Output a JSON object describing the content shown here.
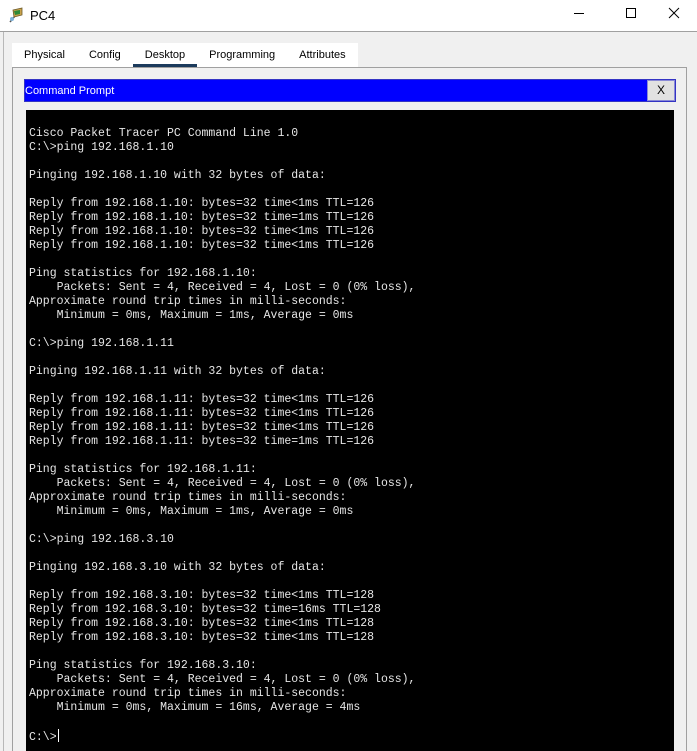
{
  "window": {
    "title": "PC4",
    "app_icon": "packet-tracer-pc-icon",
    "controls": {
      "minimize": "minimize-icon",
      "maximize": "maximize-icon",
      "close": "close-icon"
    }
  },
  "tabs": [
    {
      "label": "Physical",
      "active": false
    },
    {
      "label": "Config",
      "active": false
    },
    {
      "label": "Desktop",
      "active": true
    },
    {
      "label": "Programming",
      "active": false
    },
    {
      "label": "Attributes",
      "active": false
    }
  ],
  "command_prompt": {
    "title": "Command Prompt",
    "close_label": "X"
  },
  "terminal": {
    "lines": [
      "Cisco Packet Tracer PC Command Line 1.0",
      "C:\\>ping 192.168.1.10",
      "",
      "Pinging 192.168.1.10 with 32 bytes of data:",
      "",
      "Reply from 192.168.1.10: bytes=32 time<1ms TTL=126",
      "Reply from 192.168.1.10: bytes=32 time=1ms TTL=126",
      "Reply from 192.168.1.10: bytes=32 time<1ms TTL=126",
      "Reply from 192.168.1.10: bytes=32 time<1ms TTL=126",
      "",
      "Ping statistics for 192.168.1.10:",
      "    Packets: Sent = 4, Received = 4, Lost = 0 (0% loss),",
      "Approximate round trip times in milli-seconds:",
      "    Minimum = 0ms, Maximum = 1ms, Average = 0ms",
      "",
      "C:\\>ping 192.168.1.11",
      "",
      "Pinging 192.168.1.11 with 32 bytes of data:",
      "",
      "Reply from 192.168.1.11: bytes=32 time<1ms TTL=126",
      "Reply from 192.168.1.11: bytes=32 time<1ms TTL=126",
      "Reply from 192.168.1.11: bytes=32 time<1ms TTL=126",
      "Reply from 192.168.1.11: bytes=32 time=1ms TTL=126",
      "",
      "Ping statistics for 192.168.1.11:",
      "    Packets: Sent = 4, Received = 4, Lost = 0 (0% loss),",
      "Approximate round trip times in milli-seconds:",
      "    Minimum = 0ms, Maximum = 1ms, Average = 0ms",
      "",
      "C:\\>ping 192.168.3.10",
      "",
      "Pinging 192.168.3.10 with 32 bytes of data:",
      "",
      "Reply from 192.168.3.10: bytes=32 time<1ms TTL=128",
      "Reply from 192.168.3.10: bytes=32 time=16ms TTL=128",
      "Reply from 192.168.3.10: bytes=32 time<1ms TTL=128",
      "Reply from 192.168.3.10: bytes=32 time<1ms TTL=128",
      "",
      "Ping statistics for 192.168.3.10:",
      "    Packets: Sent = 4, Received = 4, Lost = 0 (0% loss),",
      "Approximate round trip times in milli-seconds:",
      "    Minimum = 0ms, Maximum = 16ms, Average = 4ms",
      ""
    ],
    "prompt": "C:\\>",
    "input_value": ""
  },
  "colors": {
    "header_blue": "#0000ff",
    "terminal_bg": "#000000",
    "terminal_fg": "#e6e6e6",
    "active_tab_underline": "#1b3a5c"
  }
}
